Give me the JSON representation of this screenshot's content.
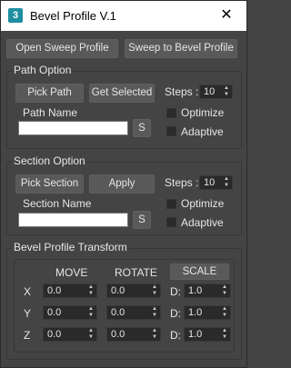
{
  "window": {
    "title": "Bevel Profile V.1",
    "close_glyph": "✕",
    "app_icon_text": "3"
  },
  "toolbar": {
    "open_sweep_label": "Open Sweep Profile",
    "sweep_to_bevel_label": "Sweep to Bevel Profile"
  },
  "path_option": {
    "group_label": "Path Option",
    "pick_path_label": "Pick Path",
    "get_selected_label": "Get Selected",
    "steps_label": "Steps :",
    "steps_value": "10",
    "path_name_label": "Path Name",
    "path_name_value": "",
    "s_button_label": "S",
    "optimize_label": "Optimize",
    "adaptive_label": "Adaptive"
  },
  "section_option": {
    "group_label": "Section Option",
    "pick_section_label": "Pick Section",
    "apply_label": "Apply",
    "steps_label": "Steps :",
    "steps_value": "10",
    "section_name_label": "Section Name",
    "section_name_value": "",
    "s_button_label": "S",
    "optimize_label": "Optimize",
    "adaptive_label": "Adaptive"
  },
  "transform": {
    "group_label": "Bevel Profile Transform",
    "move_header": "MOVE",
    "rotate_header": "ROTATE",
    "scale_header": "SCALE",
    "rows": [
      {
        "axis": "X",
        "move": "0.0",
        "rotate": "0.0",
        "d_label": "D:",
        "scale": "1.0"
      },
      {
        "axis": "Y",
        "move": "0.0",
        "rotate": "0.0",
        "d_label": "D:",
        "scale": "1.0"
      },
      {
        "axis": "Z",
        "move": "0.0",
        "rotate": "0.0",
        "d_label": "D:",
        "scale": "1.0"
      }
    ]
  },
  "spinner_arrows": "▲▼",
  "colors": {
    "background": "#444444",
    "button": "#595959",
    "field": "#2a2a2a",
    "title_bar": "#ffffff",
    "app_icon": "#1e8fa0"
  }
}
